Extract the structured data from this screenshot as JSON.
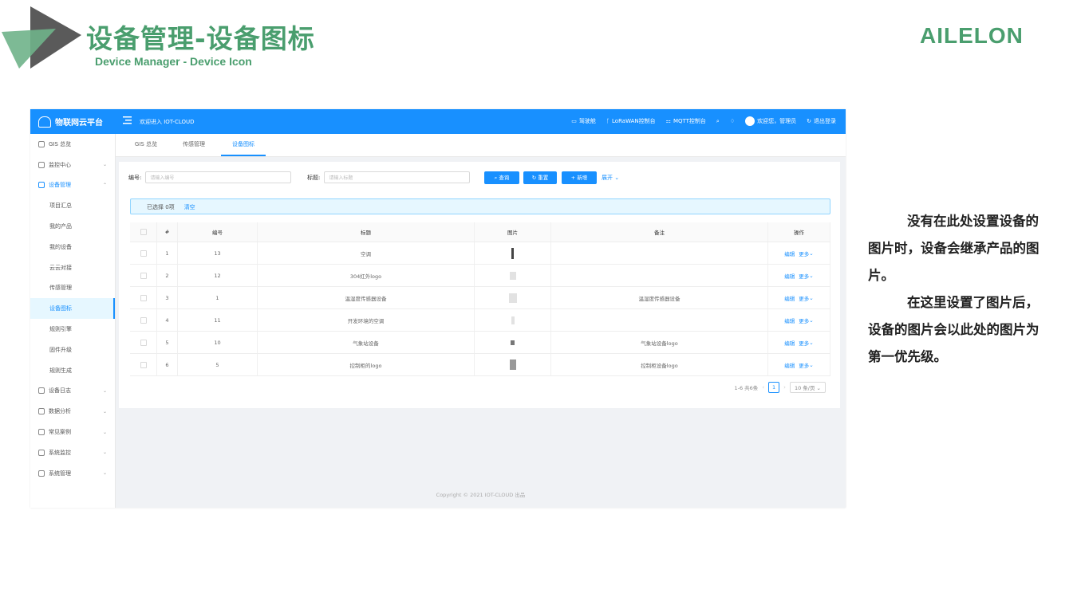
{
  "slide": {
    "title": "设备管理-设备图标",
    "subtitle": "Device Manager - Device Icon",
    "brand": "AILELON",
    "note_p1": "没有在此处设置设备的图片时，设备会继承产品的图片。",
    "note_p2": "在这里设置了图片后，设备的图片会以此处的图片为第一优先级。",
    "colors": {
      "accent": "#4a9e6e",
      "primary": "#1890ff"
    }
  },
  "topbar": {
    "logo": "物联网云平台",
    "welcome": "欢迎进入 IOT-CLOUD",
    "items": [
      "驾驶舱",
      "LoRaWAN控制台",
      "MQTT控制台"
    ],
    "user": "欢迎您，管理员",
    "logout": "退出登录"
  },
  "sidebar": {
    "items": [
      {
        "label": "GIS 总览",
        "icon": "home-icon"
      },
      {
        "label": "监控中心",
        "icon": "monitor-icon"
      },
      {
        "label": "设备管理",
        "icon": "device-icon"
      },
      {
        "label": "项目汇总"
      },
      {
        "label": "我的产品"
      },
      {
        "label": "我的设备"
      },
      {
        "label": "云云对接"
      },
      {
        "label": "传感管理"
      },
      {
        "label": "设备图标"
      },
      {
        "label": "规则引擎"
      },
      {
        "label": "固件升级"
      },
      {
        "label": "规则生成"
      },
      {
        "label": "设备日志",
        "icon": "log-icon"
      },
      {
        "label": "数据分析",
        "icon": "chart-icon"
      },
      {
        "label": "常见案例",
        "icon": "case-icon"
      },
      {
        "label": "系统监控",
        "icon": "system-monitor-icon"
      },
      {
        "label": "系统管理",
        "icon": "settings-icon"
      }
    ]
  },
  "tabs": [
    "GIS 总览",
    "传感管理",
    "设备图标"
  ],
  "filter": {
    "code_label": "编号:",
    "code_placeholder": "请输入编号",
    "title_label": "标题:",
    "title_placeholder": "请输入标题",
    "search": "查询",
    "reset": "重置",
    "add": "新增",
    "expand": "展开"
  },
  "alert": {
    "selected": "已选择 0项",
    "clear": "清空"
  },
  "table": {
    "headers": [
      "#",
      "编号",
      "标题",
      "图片",
      "备注",
      "操作"
    ],
    "rows": [
      {
        "idx": "1",
        "code": "13",
        "title": "空调",
        "remark": ""
      },
      {
        "idx": "2",
        "code": "12",
        "title": "304红外logo",
        "remark": ""
      },
      {
        "idx": "3",
        "code": "1",
        "title": "温湿度传感器设备",
        "remark": "温湿度传感器设备"
      },
      {
        "idx": "4",
        "code": "11",
        "title": "开发环境的空调",
        "remark": ""
      },
      {
        "idx": "5",
        "code": "10",
        "title": "气象站设备",
        "remark": "气象站设备logo"
      },
      {
        "idx": "6",
        "code": "5",
        "title": "控制柜的logo",
        "remark": "控制柜设备logo"
      }
    ],
    "edit": "编辑",
    "more": "更多"
  },
  "pager": {
    "total": "1-6 共6条",
    "page": "1",
    "size": "10 条/页"
  },
  "footer": "Copyright © 2021 IOT-CLOUD 出品"
}
